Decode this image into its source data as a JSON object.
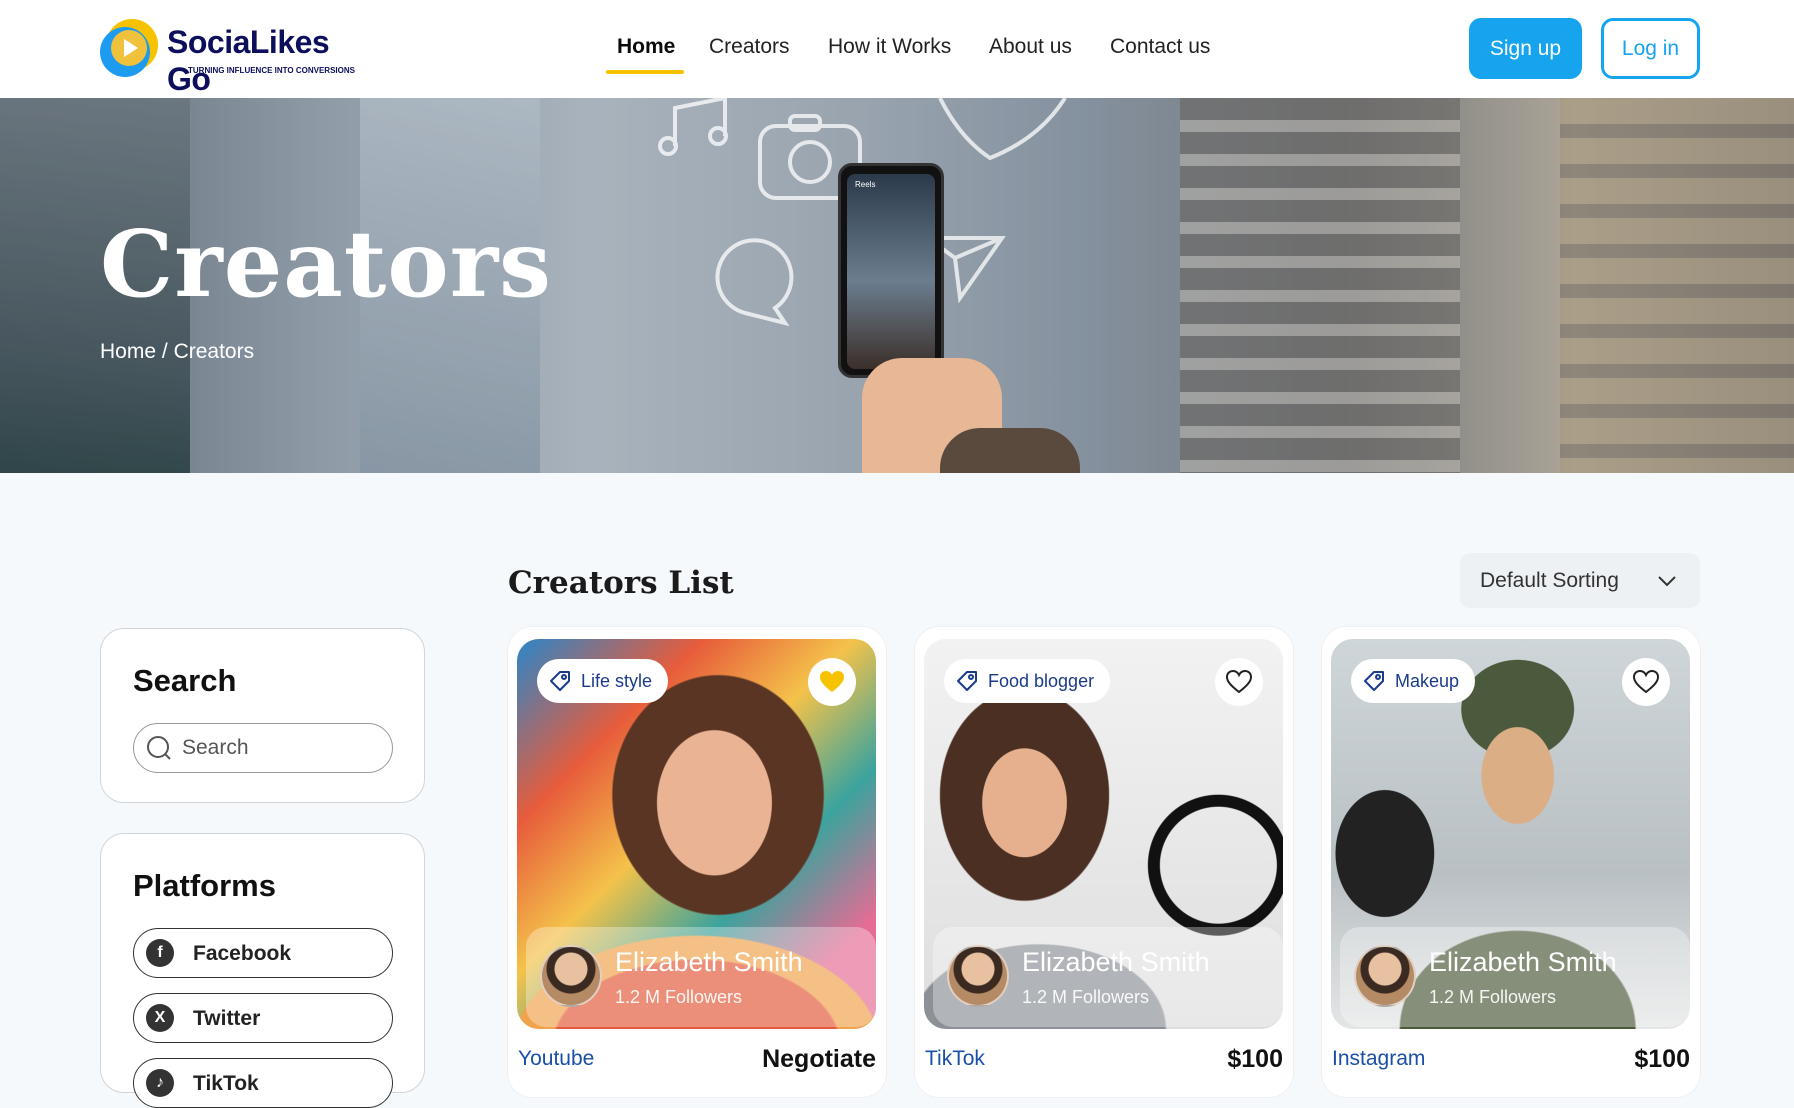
{
  "brand": {
    "name": "SociaLikes Go",
    "tagline": "TURNING INFLUENCE INTO CONVERSIONS",
    "colors": {
      "primary": "#16a4ee",
      "accent": "#f7c300",
      "brand_text": "#0d0e5c"
    }
  },
  "nav": {
    "items": [
      {
        "label": "Home",
        "active": true
      },
      {
        "label": "Creators",
        "active": false
      },
      {
        "label": "How it Works",
        "active": false
      },
      {
        "label": "About us",
        "active": false
      },
      {
        "label": "Contact us",
        "active": false
      }
    ],
    "signup_label": "Sign up",
    "login_label": "Log in"
  },
  "hero": {
    "title": "Creators",
    "breadcrumb": {
      "home": "Home",
      "separator": "/",
      "current": "Creators"
    },
    "phone_label": "Reels"
  },
  "sidebar": {
    "search": {
      "title": "Search",
      "placeholder": "Search",
      "value": ""
    },
    "platforms": {
      "title": "Platforms",
      "items": [
        {
          "label": "Facebook",
          "icon": "facebook-icon"
        },
        {
          "label": "Twitter",
          "icon": "x-twitter-icon"
        },
        {
          "label": "TikTok",
          "icon": "tiktok-icon"
        }
      ]
    }
  },
  "main": {
    "list_title": "Creators List",
    "sort": {
      "selected": "Default Sorting",
      "icon": "chevron-down-icon"
    },
    "cards": [
      {
        "category": "Life style",
        "favorited": true,
        "name": "Elizabeth Smith",
        "followers": "1.2 M Followers",
        "platform": "Youtube",
        "price": "Negotiate"
      },
      {
        "category": "Food blogger",
        "favorited": false,
        "name": "Elizabeth Smith",
        "followers": "1.2 M Followers",
        "platform": "TikTok",
        "price": "$100"
      },
      {
        "category": "Makeup",
        "favorited": false,
        "name": "Elizabeth Smith",
        "followers": "1.2 M Followers",
        "platform": "Instagram",
        "price": "$100"
      }
    ]
  }
}
